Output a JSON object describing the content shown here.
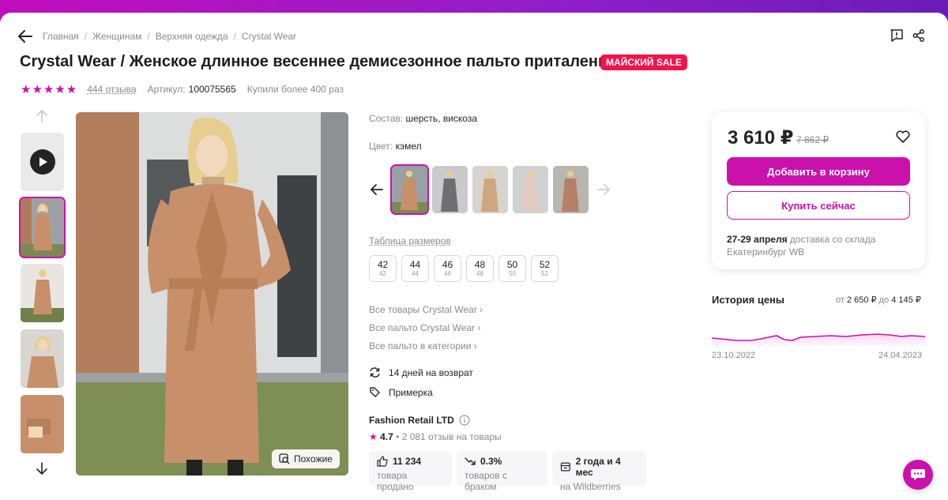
{
  "breadcrumb": [
    "Главная",
    "Женщинам",
    "Верхняя одежда",
    "Crystal Wear"
  ],
  "title": "Crystal Wear / Женское длинное весеннее демисезонное пальто приталенное",
  "sale_badge": "МАЙСКИЙ SALE",
  "rating": {
    "stars": 5,
    "reviews_link": "444 отзыва",
    "article_label": "Артикул:",
    "article_value": "100075565",
    "bought": "Купили более 400 раз"
  },
  "gallery": {
    "similar_label": "Похожие"
  },
  "details": {
    "composition_label": "Состав:",
    "composition_value": "шерсть, вискоза",
    "color_label": "Цвет:",
    "color_value": "кэмел",
    "size_table_link": "Таблица размеров",
    "sizes": [
      {
        "n": "42",
        "s": "42"
      },
      {
        "n": "44",
        "s": "44"
      },
      {
        "n": "46",
        "s": "46"
      },
      {
        "n": "48",
        "s": "48"
      },
      {
        "n": "50",
        "s": "50"
      },
      {
        "n": "52",
        "s": "52"
      }
    ],
    "links": [
      "Все товары Crystal Wear",
      "Все пальто Crystal Wear",
      "Все пальто в категории"
    ],
    "return_label": "14 дней на возврат",
    "fitting_label": "Примерка"
  },
  "seller": {
    "name": "Fashion Retail LTD",
    "rating": "4.7",
    "reviews": "2 081 отзыв на товары",
    "stats": [
      {
        "value": "11 234",
        "label": "товара продано",
        "icon": "thumbs-up-icon"
      },
      {
        "value": "0.3%",
        "label": "товаров с браком",
        "icon": "trend-down-icon"
      },
      {
        "value": "2 года и 4 мес",
        "label": "на Wildberries",
        "icon": "store-icon"
      }
    ]
  },
  "price_card": {
    "price": "3 610 ₽",
    "old_price": "7 862 ₽",
    "cart_button": "Добавить в корзину",
    "buy_button": "Купить сейчас",
    "delivery_date": "27-29 апреля",
    "delivery_text": "доставка со склада",
    "delivery_city": "Екатеринбург WB"
  },
  "price_history": {
    "title": "История цены",
    "range_from_label": "от",
    "range_from": "2 650 ₽",
    "range_to_label": "до",
    "range_to": "4 145 ₽",
    "date_start": "23.10.2022",
    "date_end": "24.04.2023"
  },
  "colors": {
    "accent": "#cb11ab",
    "sale": "#f5124b",
    "coat": "#c8906a"
  }
}
